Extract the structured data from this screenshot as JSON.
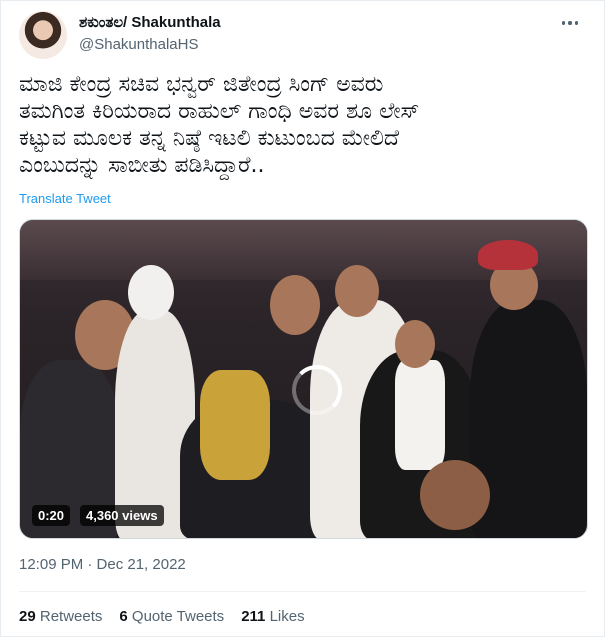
{
  "author": {
    "name": "ಶಕುಂತಲ/ Shakunthala",
    "handle": "@ShakunthalaHS"
  },
  "tweet": {
    "text": "ಮಾಜಿ ಕೇಂದ್ರ ಸಚಿವ ಭನ್ವರ್ ಜಿತೇಂದ್ರ ಸಿಂಗ್ ಅವರು\nತಮಗಿಂತ ಕಿರಿಯರಾದ ರಾಹುಲ್ ಗಾಂಧಿ ಅವರ ಶೂ ಲೇಸ್\nಕಟ್ಟುವ ಮೂಲಕ ತನ್ನ ನಿಷ್ಠೆ ಇಟಲಿ ಕುಟುಂಬದ ಮೇಲಿದೆ\nಎಂಬುದನ್ನು ಸಾಬೀತು ಪಡಿಸಿದ್ದಾರೆ..",
    "translate_label": "Translate Tweet"
  },
  "video": {
    "duration": "0:20",
    "views": "4,360 views"
  },
  "timestamp": "12:09 PM · Dec 21, 2022",
  "stats": {
    "retweets_count": "29",
    "retweets_label": "Retweets",
    "quotes_count": "6",
    "quotes_label": "Quote Tweets",
    "likes_count": "211",
    "likes_label": "Likes"
  },
  "colors": {
    "link": "#1d9bf0",
    "secondary_text": "#536471",
    "primary_text": "#0f1419"
  },
  "icons": {
    "more": "more-icon",
    "spinner": "loading-spinner-icon"
  }
}
